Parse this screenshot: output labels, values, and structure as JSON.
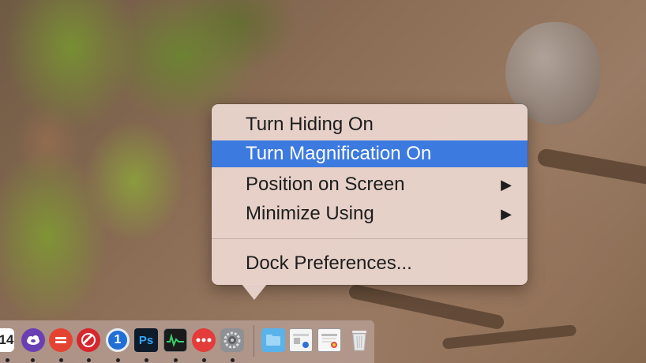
{
  "menu": {
    "items": [
      {
        "label": "Turn Hiding On",
        "submenu": false,
        "highlighted": false
      },
      {
        "label": "Turn Magnification On",
        "submenu": false,
        "highlighted": true
      },
      {
        "label": "Position on Screen",
        "submenu": true,
        "highlighted": false
      },
      {
        "label": "Minimize Using",
        "submenu": true,
        "highlighted": false
      },
      {
        "label": "Dock Preferences...",
        "submenu": false,
        "highlighted": false
      }
    ],
    "submenu_arrow": "▶",
    "highlight_color": "#3c7ae0"
  },
  "dock": {
    "calendar_day": "14",
    "photoshop_label": "Ps",
    "onepassword_label": "1",
    "icons": [
      {
        "name": "calendar-icon",
        "running": true
      },
      {
        "name": "fantastical-icon",
        "running": true
      },
      {
        "name": "todoist-icon",
        "running": true
      },
      {
        "name": "adobe-creative-cloud-icon",
        "running": true
      },
      {
        "name": "1password-icon",
        "running": true
      },
      {
        "name": "photoshop-icon",
        "running": true
      },
      {
        "name": "activity-monitor-icon",
        "running": true
      },
      {
        "name": "overflow-app-icon",
        "running": true
      },
      {
        "name": "system-preferences-icon",
        "running": true
      },
      {
        "name": "folder-icon",
        "running": false
      },
      {
        "name": "window-thumbnail-icon",
        "running": false
      },
      {
        "name": "browser-window-icon",
        "running": false
      },
      {
        "name": "trash-icon",
        "running": false
      }
    ]
  }
}
